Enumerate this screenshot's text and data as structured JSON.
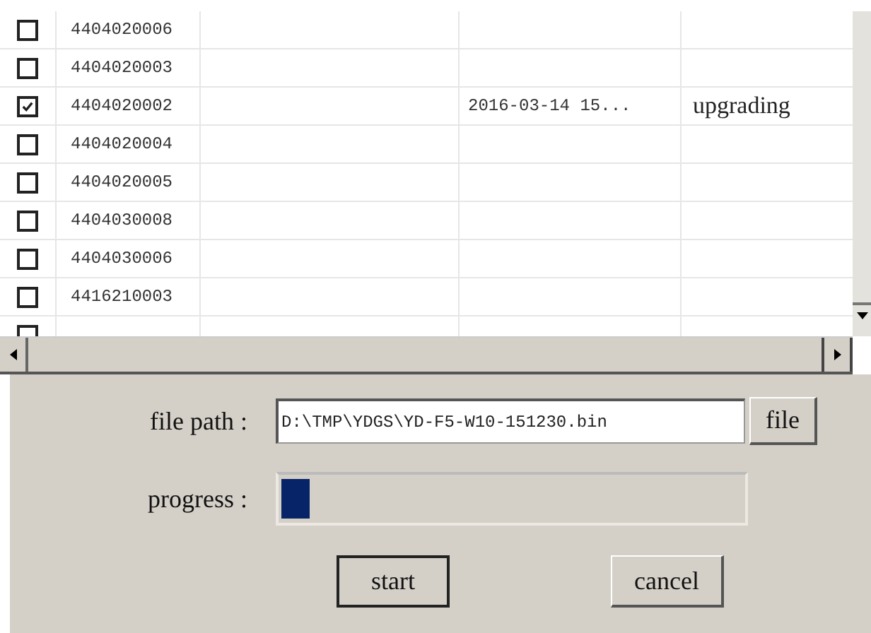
{
  "table": {
    "rows": [
      {
        "checked": false,
        "id": "4404020006"
      },
      {
        "checked": false,
        "id": "4404020003"
      },
      {
        "checked": true,
        "id": "4404020002",
        "time": "2016-03-14 15...",
        "status": "upgrading"
      },
      {
        "checked": false,
        "id": "4404020004"
      },
      {
        "checked": false,
        "id": "4404020005"
      },
      {
        "checked": false,
        "id": "4404030008"
      },
      {
        "checked": false,
        "id": "4404030006"
      },
      {
        "checked": false,
        "id": "4416210003"
      },
      {
        "checked": false
      }
    ]
  },
  "form": {
    "file_label": "file path :",
    "file_path": "D:\\TMP\\YDGS\\YD-F5-W10-151230.bin",
    "file_button": "file",
    "progress_label": "progress :",
    "progress": {
      "level": 0.06
    },
    "buttons": [
      "start",
      "cancel"
    ]
  }
}
